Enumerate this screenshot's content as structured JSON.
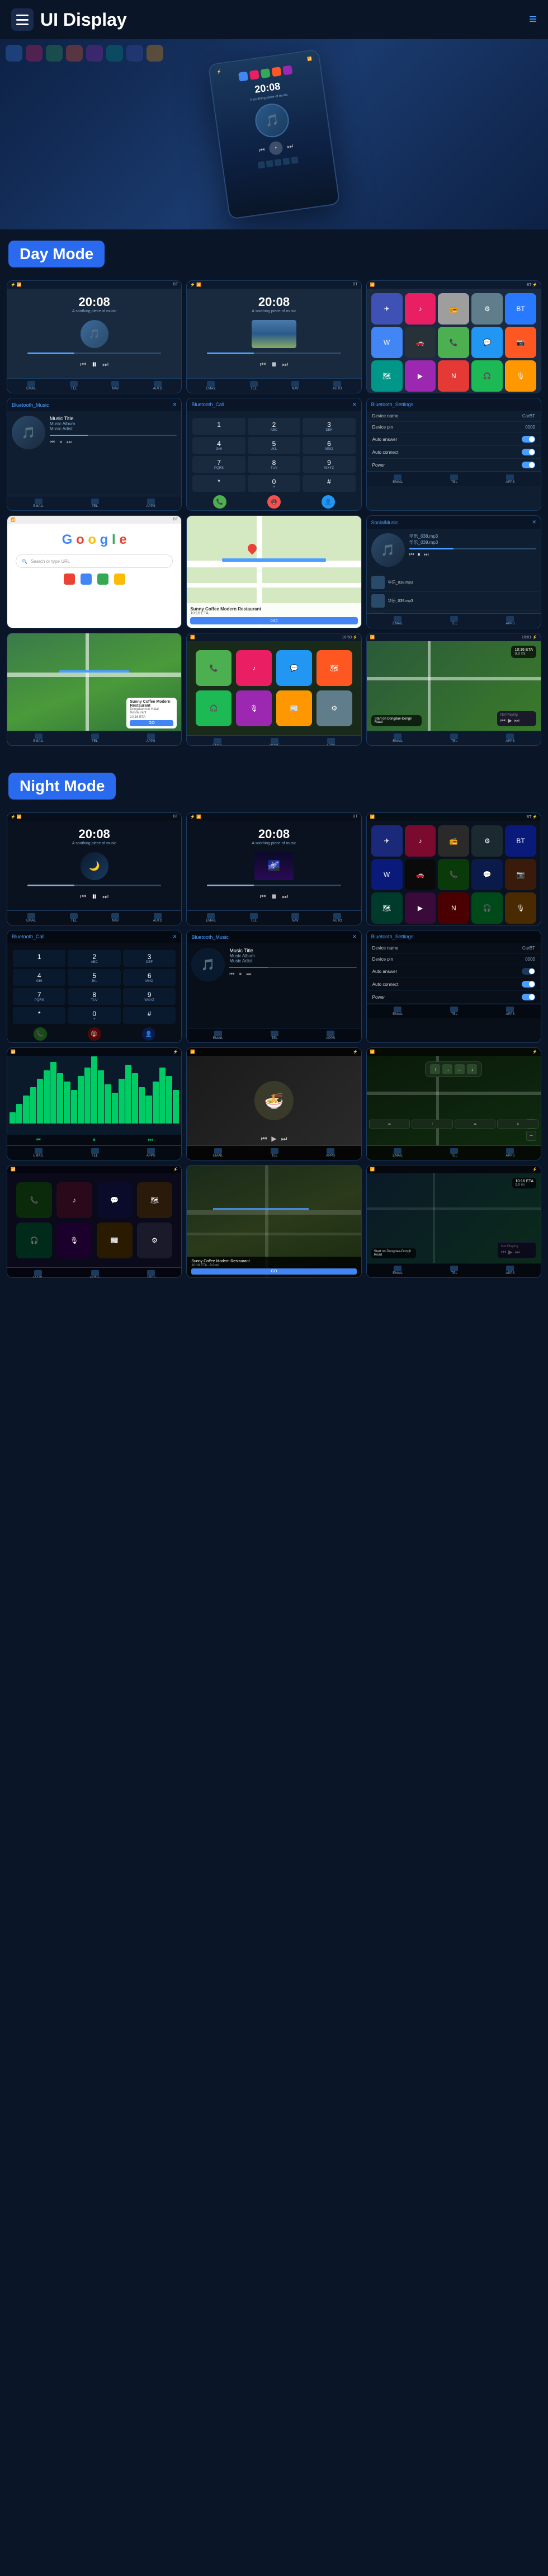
{
  "header": {
    "title": "UI Display",
    "menu_label": "menu",
    "nav_icon": "≡"
  },
  "hero": {
    "device_time": "20:08",
    "device_subtitle": "A soothing piece of music"
  },
  "day_mode": {
    "label": "Day Mode",
    "screens": [
      {
        "type": "music",
        "time": "20:08",
        "subtitle": "A soothing piece of music"
      },
      {
        "type": "music2",
        "time": "20:08",
        "subtitle": "A soothing piece of music"
      },
      {
        "type": "appgrid"
      },
      {
        "type": "bt_music",
        "title": "Bluetooth_Music",
        "track": "Music Title",
        "album": "Music Album",
        "artist": "Music Artist"
      },
      {
        "type": "bt_call",
        "title": "Bluetooth_Call"
      },
      {
        "type": "settings",
        "title": "Bluetooth_Settings"
      },
      {
        "type": "google"
      },
      {
        "type": "map"
      },
      {
        "type": "social_music",
        "title": "SocialMusic"
      }
    ]
  },
  "day_mode_row2": {
    "screens": [
      {
        "type": "nav_map"
      },
      {
        "type": "carplay"
      },
      {
        "type": "playing"
      }
    ]
  },
  "night_mode": {
    "label": "Night Mode",
    "screens": [
      {
        "type": "music_night",
        "time": "20:08"
      },
      {
        "type": "music_night2",
        "time": "20:08"
      },
      {
        "type": "appgrid_night"
      },
      {
        "type": "bt_call_night",
        "title": "Bluetooth_Call"
      },
      {
        "type": "bt_music_night",
        "title": "Bluetooth_Music",
        "track": "Music Title",
        "album": "Music Album",
        "artist": "Music Artist"
      },
      {
        "type": "settings_night",
        "title": "Bluetooth_Settings"
      },
      {
        "type": "wave"
      },
      {
        "type": "video"
      },
      {
        "type": "nav_night"
      }
    ]
  },
  "night_mode_row2": {
    "screens": [
      {
        "type": "carplay_night"
      },
      {
        "type": "map_night"
      },
      {
        "type": "playing_night"
      }
    ]
  },
  "settings_items": [
    {
      "label": "Device name",
      "value": "CarBT"
    },
    {
      "label": "Device pin",
      "value": "0000"
    },
    {
      "label": "Auto answer",
      "value": "toggle"
    },
    {
      "label": "Auto connect",
      "value": "toggle"
    },
    {
      "label": "Power",
      "value": "toggle"
    }
  ],
  "dialpad": {
    "keys": [
      {
        "main": "1",
        "sub": ""
      },
      {
        "main": "2",
        "sub": "ABC"
      },
      {
        "main": "3",
        "sub": "DEF"
      },
      {
        "main": "4",
        "sub": "GHI"
      },
      {
        "main": "5",
        "sub": "JKL"
      },
      {
        "main": "6",
        "sub": "MNO"
      },
      {
        "main": "7",
        "sub": "PQRS"
      },
      {
        "main": "8",
        "sub": "TUV"
      },
      {
        "main": "9",
        "sub": "WXYZ"
      },
      {
        "main": "*",
        "sub": ""
      },
      {
        "main": "0",
        "sub": "+"
      },
      {
        "main": "#",
        "sub": ""
      }
    ]
  },
  "wave_heights": [
    20,
    35,
    50,
    65,
    80,
    95,
    110,
    90,
    75,
    60,
    85,
    100,
    120,
    95,
    70,
    55,
    80,
    105,
    90,
    65,
    50,
    75,
    100,
    85,
    60
  ],
  "nav": {
    "eta": "10:16 ETA",
    "distance": "9.0 mi",
    "instruction": "Start on Dongdae-Dongil Road",
    "time_remaining": "19:16 ETA",
    "distance_remaining": "9.0 mi"
  },
  "coffee_shop": {
    "name": "Sunny Coffee Modern Restaurant",
    "address": "Dongdaemun Halal Restaurant",
    "eta": "10:16 ETA",
    "go_label": "GO"
  },
  "music_track": {
    "title": "Music Title",
    "album": "Music Album",
    "artist": "Music Artist"
  },
  "app_colors": {
    "phone": "#4caf50",
    "music": "#e91e63",
    "maps": "#34a853",
    "messages": "#2196f3",
    "settings": "#607d8b",
    "camera": "#9e9e9e",
    "telegram": "#2196f3",
    "waze": "#4a9eff",
    "bt": "#2979ff",
    "spotify": "#1db954",
    "youtube": "#f44336",
    "netflix": "#e50914",
    "podcasts": "#9c27b0",
    "news": "#ef5350"
  }
}
